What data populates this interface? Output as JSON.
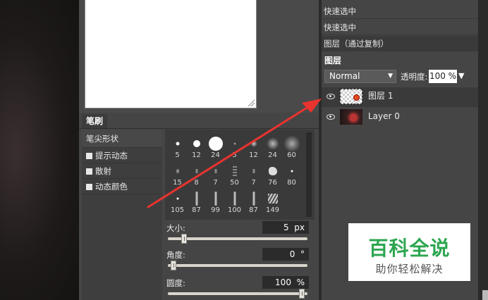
{
  "brush_panel": {
    "tab": "笔刷",
    "list": [
      {
        "label": "笔尖形状",
        "checkbox": false
      },
      {
        "label": "提示动态",
        "checkbox": true
      },
      {
        "label": "散射",
        "checkbox": true
      },
      {
        "label": "动态颜色",
        "checkbox": true
      }
    ],
    "tips": [
      {
        "size": "5",
        "shape": "dot-s"
      },
      {
        "size": "12",
        "shape": "dot-m"
      },
      {
        "size": "24",
        "shape": "dot-l"
      },
      {
        "size": "5",
        "shape": "soft-xs"
      },
      {
        "size": "12",
        "shape": "soft-s"
      },
      {
        "size": "24",
        "shape": "soft-m"
      },
      {
        "size": "60",
        "shape": "soft-l"
      },
      {
        "size": "15",
        "shape": "spray-s"
      },
      {
        "size": "8",
        "shape": "spray-xs"
      },
      {
        "size": "7",
        "shape": "spray-xs"
      },
      {
        "size": "50",
        "shape": "spray-m"
      },
      {
        "size": "7",
        "shape": "spray-xs"
      },
      {
        "size": "76",
        "shape": "blob"
      },
      {
        "size": "80",
        "shape": "dot-xs"
      },
      {
        "size": "105",
        "shape": "dot-xs"
      },
      {
        "size": "87",
        "shape": "stroke"
      },
      {
        "size": "99",
        "shape": "stroke"
      },
      {
        "size": "100",
        "shape": "stroke"
      },
      {
        "size": "87",
        "shape": "stroke"
      },
      {
        "size": "149",
        "shape": "texture"
      }
    ],
    "size_label": "大小:",
    "size_value": "5",
    "size_unit": "px",
    "size_level": 0.1,
    "angle_label": "角度:",
    "angle_value": "0",
    "angle_unit": "°",
    "angle_level": 0.02,
    "roundness_label": "圆度:",
    "roundness_value": "100",
    "roundness_unit": "%",
    "roundness_level": 0.98
  },
  "history": {
    "items": [
      "快速选中",
      "快速选中",
      "图层（通过复制）"
    ]
  },
  "layers": {
    "tab": "图层",
    "blend_mode": "Normal",
    "opacity_label": "透明度:",
    "opacity_value": "100 %",
    "items": [
      {
        "name": "图层 1",
        "selected": true
      },
      {
        "name": "Layer 0",
        "selected": false
      }
    ]
  },
  "watermark": {
    "title": "百科全说",
    "subtitle": "助你轻松解决"
  },
  "colors": {
    "arrow": "#e8332f",
    "watermark_green": "#2ca650"
  }
}
